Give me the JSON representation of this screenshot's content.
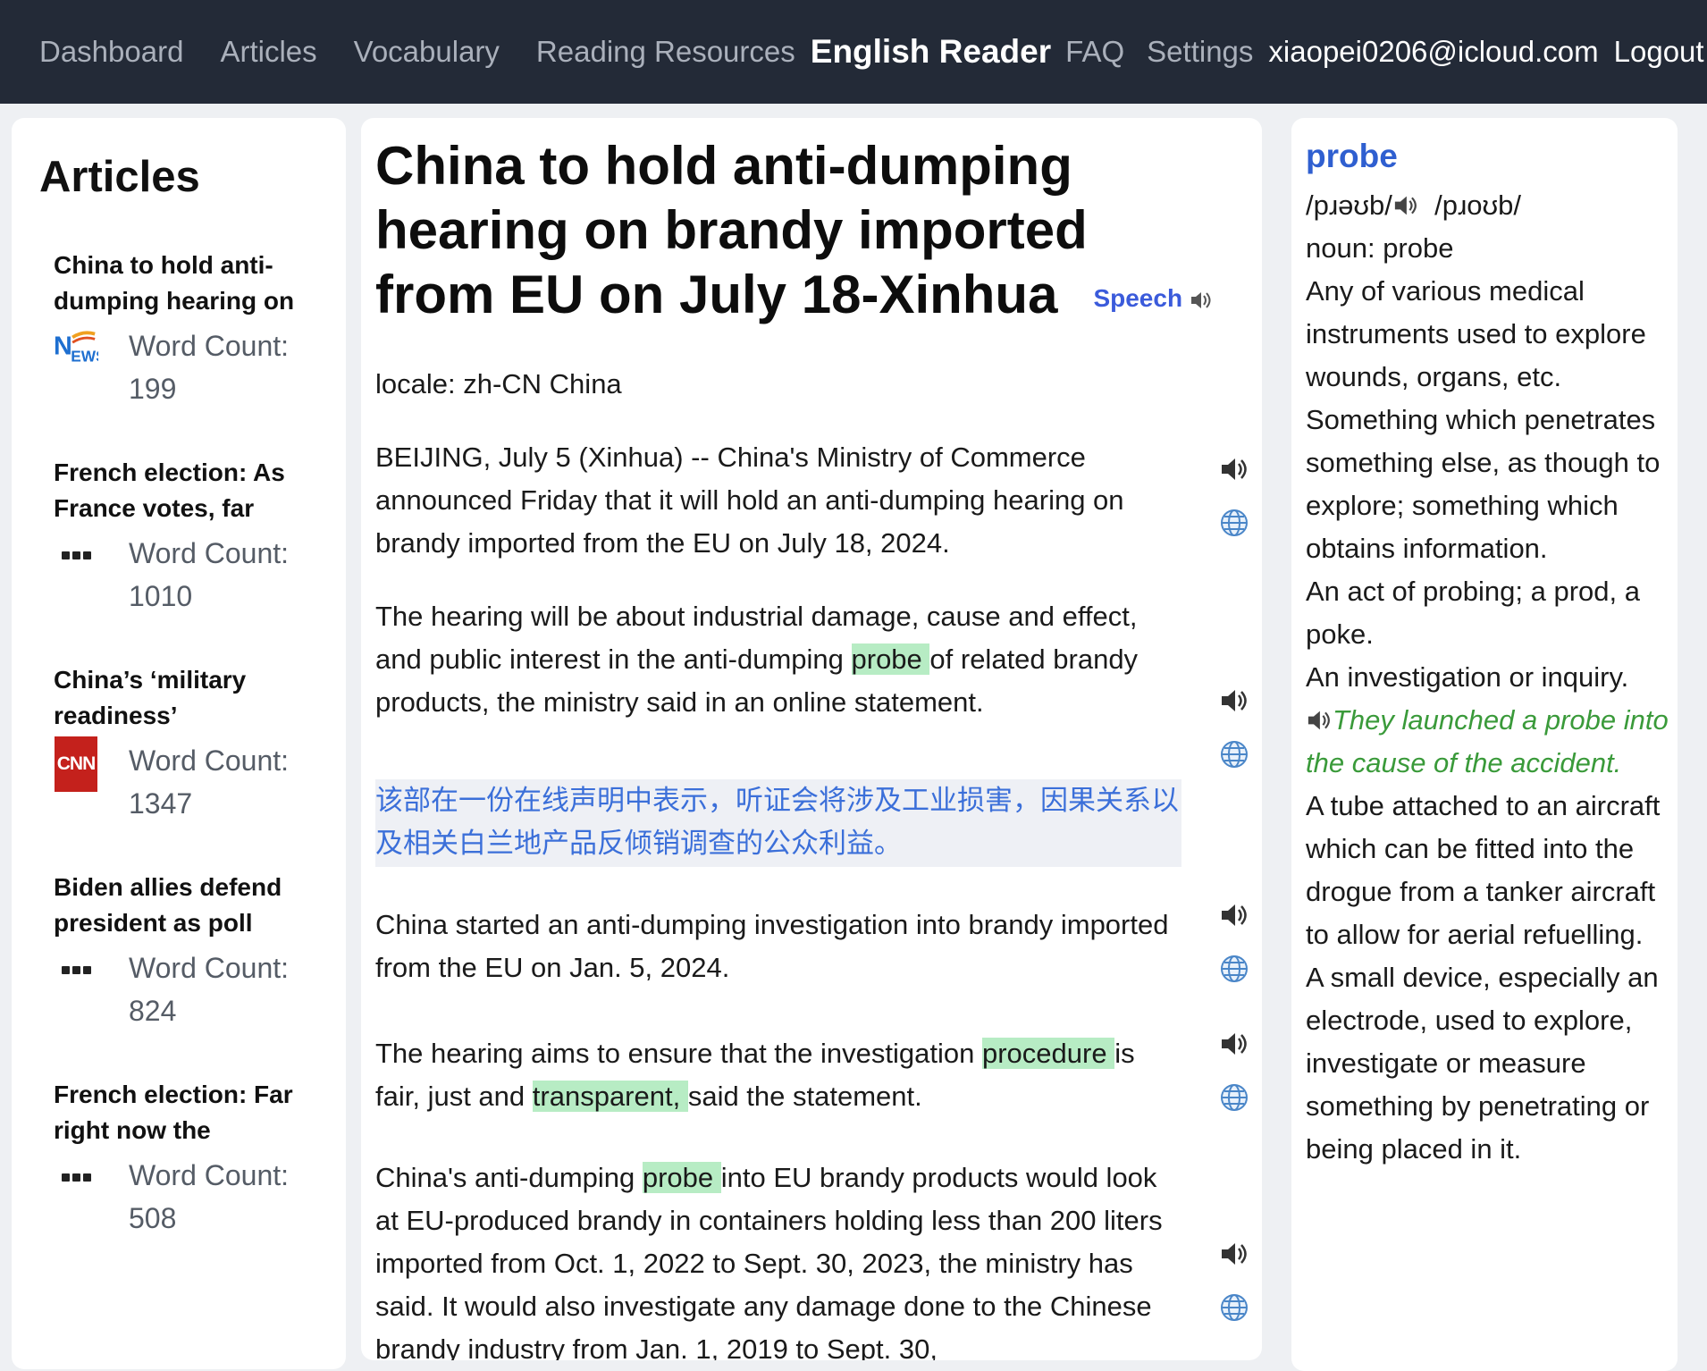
{
  "nav": {
    "links": [
      "Dashboard",
      "Articles",
      "Vocabulary",
      "Reading Resources"
    ],
    "brand": "English Reader",
    "faq": "FAQ",
    "settings": "Settings",
    "user": "xiaopei0206@icloud.com",
    "logout": "Logout"
  },
  "sidebar": {
    "heading": "Articles",
    "items": [
      {
        "title": "China to hold anti-dumping hearing on",
        "logo": "news-logo-icon",
        "wc_label": "Word Count:",
        "wc": "199"
      },
      {
        "title": "French election: As France votes, far",
        "logo": "dots-icon",
        "wc_label": "Word Count:",
        "wc": "1010"
      },
      {
        "title": "China’s ‘military readiness’",
        "logo": "cnn-logo-icon",
        "logo_text": "CNN",
        "wc_label": "Word Count:",
        "wc": "1347"
      },
      {
        "title": "Biden allies defend president as poll",
        "logo": "dots-icon",
        "wc_label": "Word Count:",
        "wc": "824"
      },
      {
        "title": "French election: Far right now the",
        "logo": "dots-icon",
        "wc_label": "Word Count:",
        "wc": "508"
      }
    ]
  },
  "article": {
    "title": "China to hold anti-dumping hearing on brandy imported from EU on July 18-Xinhua",
    "speech_label": "Speech",
    "locale": "locale: zh-CN China",
    "p1": "BEIJING, July 5 (Xinhua) -- China's Ministry of Commerce announced Friday that it will hold an anti-dumping hearing on brandy imported from the EU on July 18, 2024.",
    "p2": {
      "a": "The hearing will be about industrial damage, cause and effect, and public interest in the anti-dumping ",
      "hl": "probe ",
      "b": "of related brandy products, the ministry said in an online statement."
    },
    "p2_translation": "该部在一份在线声明中表示，听证会将涉及工业损害，因果关系以及相关白兰地产品反倾销调查的公众利益。",
    "p3": "China started an anti-dumping investigation into brandy imported from the EU on Jan. 5, 2024.",
    "p4": {
      "a": "The hearing aims to ensure that the investigation ",
      "hl1": "procedure ",
      "b": "is fair, just and ",
      "hl2": "transparent, ",
      "c": "said the statement."
    },
    "p5": {
      "a": "China's anti-dumping ",
      "hl": "probe ",
      "b": "into EU brandy products would look at EU-produced brandy in containers holding less than 200 liters imported from Oct. 1, 2022 to Sept. 30, 2023, the ministry has said. It would also investigate any damage done to the Chinese brandy industry from Jan. 1, 2019 to Sept. 30,"
    }
  },
  "dictionary": {
    "word": "probe",
    "pron_uk": "/pɹəʊb/",
    "pron_us": "/pɹoʊb/",
    "pos": "noun: probe",
    "definitions": [
      "Any of various medical instruments used to explore wounds, organs, etc.",
      "Something which penetrates something else, as though to explore; something which obtains information.",
      "An act of probing; a prod, a poke.",
      "An investigation or inquiry."
    ],
    "example": "They launched a probe into the cause of the accident.",
    "definitions2": [
      "A tube attached to an aircraft which can be fitted into the drogue from a tanker aircraft to allow for aerial refuelling.",
      "A small device, especially an electrode, used to explore, investigate or measure something by penetrating or being placed in it."
    ]
  }
}
